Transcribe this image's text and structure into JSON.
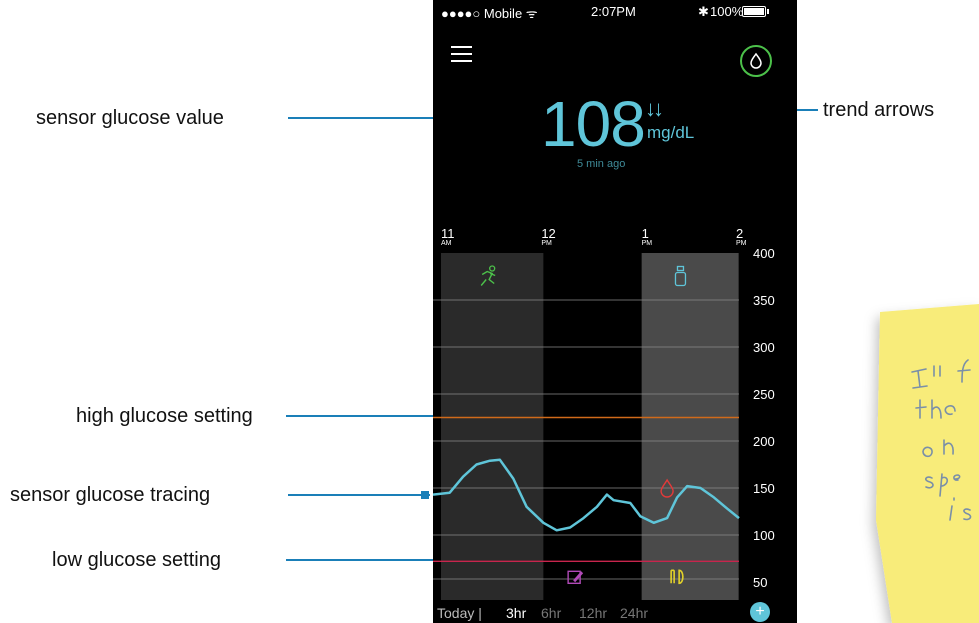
{
  "annotations": {
    "sensor_glucose_value": "sensor glucose value",
    "trend_arrows": "trend arrows",
    "high_glucose_setting": "high glucose setting",
    "sensor_glucose_tracing": "sensor glucose tracing",
    "low_glucose_setting": "low glucose setting"
  },
  "status_bar": {
    "carrier": "●●●●○ Mobile ᯤ",
    "time": "2:07PM",
    "bluetooth": "✱",
    "battery": "100%"
  },
  "header": {
    "menu_icon": "hamburger-menu-icon",
    "drop_icon": "blood-drop-icon"
  },
  "reading": {
    "value": "108",
    "trend": "↓↓",
    "unit": "mg/dL",
    "age": "5 min ago"
  },
  "chart_data": {
    "type": "line",
    "time_ticks": [
      {
        "hour": "11",
        "ampm": "AM",
        "t": 0
      },
      {
        "hour": "12",
        "ampm": "PM",
        "t": 60
      },
      {
        "hour": "1",
        "ampm": "PM",
        "t": 120
      },
      {
        "hour": "2",
        "ampm": "PM",
        "t": 180
      }
    ],
    "x_range_minutes": [
      0,
      183
    ],
    "y_ticks": [
      50,
      100,
      150,
      200,
      250,
      300,
      350,
      400
    ],
    "ylim": [
      30,
      400
    ],
    "high_setting": 225,
    "low_setting": 72,
    "colors": {
      "trace": "#5fc5d9",
      "high_line": "#d06a1a",
      "low_line": "#c8254d",
      "band_dark": "#2a2a2a",
      "band_light": "#4a4a4a",
      "exercise": "#4cc14a",
      "insulin": "#5fc5d9",
      "bg_meter": "#e23a3a",
      "note": "#b14ab8",
      "meal": "#e2d12a"
    },
    "bands": [
      {
        "start": 0,
        "end": 66,
        "shade": "band_dark"
      },
      {
        "start": 120,
        "end": 178,
        "shade": "band_light"
      }
    ],
    "series": [
      {
        "points": [
          [
            0,
            143
          ],
          [
            10,
            145
          ],
          [
            18,
            162
          ],
          [
            26,
            175
          ],
          [
            34,
            179
          ],
          [
            40,
            180
          ],
          [
            48,
            160
          ],
          [
            56,
            130
          ],
          [
            66,
            113
          ],
          [
            74,
            105
          ],
          [
            82,
            108
          ],
          [
            90,
            118
          ],
          [
            98,
            130
          ],
          [
            104,
            143
          ],
          [
            108,
            137
          ],
          [
            118,
            134
          ],
          [
            124,
            120
          ],
          [
            132,
            113
          ],
          [
            140,
            118
          ],
          [
            146,
            140
          ],
          [
            152,
            152
          ],
          [
            160,
            150
          ],
          [
            168,
            140
          ],
          [
            176,
            128
          ],
          [
            183,
            118
          ]
        ]
      }
    ],
    "markers": [
      {
        "icon": "exercise-icon",
        "t": 33,
        "y": 375,
        "color": "exercise"
      },
      {
        "icon": "insulin-icon",
        "t": 148,
        "y": 375,
        "color": "insulin"
      },
      {
        "icon": "bg-meter-drop-icon",
        "t": 140,
        "y": 150,
        "color": "bg_meter"
      },
      {
        "icon": "note-icon",
        "t": 85,
        "y": 55,
        "color": "note"
      },
      {
        "icon": "meal-icon",
        "t": 146,
        "y": 55,
        "color": "meal"
      }
    ]
  },
  "range_selector": {
    "today": "Today |",
    "options": [
      "3hr",
      "6hr",
      "12hr",
      "24hr"
    ],
    "selected": "3hr"
  }
}
